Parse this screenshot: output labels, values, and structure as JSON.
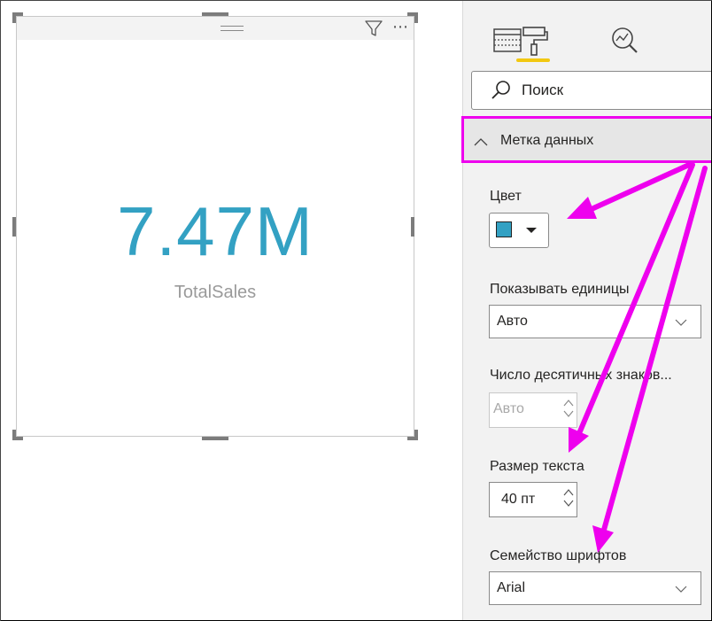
{
  "card": {
    "value": "7.47M",
    "label": "TotalSales",
    "value_color": "#33a1c3"
  },
  "pane": {
    "tabs": [
      {
        "icon": "fields-icon"
      },
      {
        "icon": "format-paint-roller-icon",
        "active": true
      },
      {
        "icon": "analytics-magnifier-icon"
      }
    ],
    "search": {
      "placeholder": "Поиск"
    },
    "section": {
      "title": "Метка данных",
      "expanded": true
    },
    "fields": {
      "color": {
        "label": "Цвет",
        "value": "#33a1c3"
      },
      "display_units": {
        "label": "Показывать единицы",
        "value": "Авто"
      },
      "decimal_places": {
        "label": "Число десятичных знаков...",
        "value": "Авто"
      },
      "text_size": {
        "label": "Размер текста",
        "value": "40 пт"
      },
      "font_family": {
        "label": "Семейство шрифтов",
        "value": "Arial"
      }
    }
  },
  "colors": {
    "accent": "#33a1c3",
    "highlight": "#ee00ee",
    "active_tab": "#f2c811"
  }
}
